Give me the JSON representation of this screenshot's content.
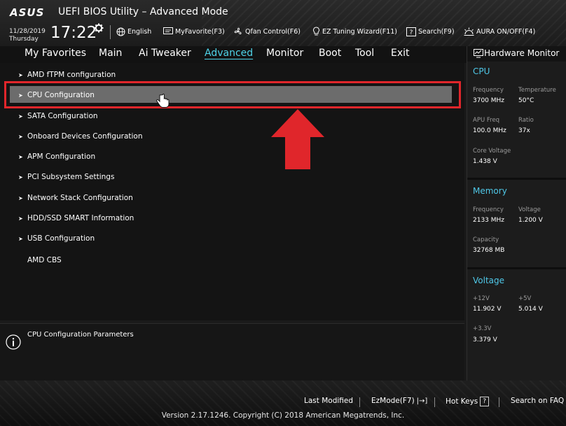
{
  "header": {
    "brand": "ASUS",
    "title": "UEFI BIOS Utility – Advanced Mode",
    "date": "11/28/2019",
    "weekday": "Thursday",
    "time": "17:22",
    "tools": [
      {
        "label": "English",
        "icon": "globe-icon"
      },
      {
        "label": "MyFavorite(F3)",
        "icon": "favorite-screen-icon"
      },
      {
        "label": "Qfan Control(F6)",
        "icon": "fan-icon"
      },
      {
        "label": "EZ Tuning Wizard(F11)",
        "icon": "bulb-icon"
      },
      {
        "label": "Search(F9)",
        "icon": "search-help-icon"
      },
      {
        "label": "AURA ON/OFF(F4)",
        "icon": "aura-icon"
      }
    ]
  },
  "tabs": [
    {
      "label": "My Favorites",
      "active": false
    },
    {
      "label": "Main",
      "active": false
    },
    {
      "label": "Ai Tweaker",
      "active": false
    },
    {
      "label": "Advanced",
      "active": true
    },
    {
      "label": "Monitor",
      "active": false
    },
    {
      "label": "Boot",
      "active": false
    },
    {
      "label": "Tool",
      "active": false
    },
    {
      "label": "Exit",
      "active": false
    }
  ],
  "menu": [
    {
      "label": "AMD fTPM configuration",
      "arrow": true
    },
    {
      "label": "CPU Configuration",
      "arrow": true,
      "selected": true
    },
    {
      "label": "SATA Configuration",
      "arrow": true
    },
    {
      "label": "Onboard Devices Configuration",
      "arrow": true
    },
    {
      "label": "APM Configuration",
      "arrow": true
    },
    {
      "label": "PCI Subsystem Settings",
      "arrow": true
    },
    {
      "label": "Network Stack Configuration",
      "arrow": true
    },
    {
      "label": "HDD/SSD SMART Information",
      "arrow": true
    },
    {
      "label": "USB Configuration",
      "arrow": true
    },
    {
      "label": "AMD CBS",
      "arrow": false
    }
  ],
  "info": {
    "text": "CPU Configuration Parameters"
  },
  "hwmon": {
    "title": "Hardware Monitor",
    "cpu": {
      "heading": "CPU",
      "frequency_label": "Frequency",
      "frequency": "3700 MHz",
      "temperature_label": "Temperature",
      "temperature": "50°C",
      "apu_label": "APU Freq",
      "apu": "100.0 MHz",
      "ratio_label": "Ratio",
      "ratio": "37x",
      "core_voltage_label": "Core Voltage",
      "core_voltage": "1.438 V"
    },
    "memory": {
      "heading": "Memory",
      "frequency_label": "Frequency",
      "frequency": "2133 MHz",
      "voltage_label": "Voltage",
      "voltage": "1.200 V",
      "capacity_label": "Capacity",
      "capacity": "32768 MB"
    },
    "voltage": {
      "heading": "Voltage",
      "v12_label": "+12V",
      "v12": "11.902 V",
      "v5_label": "+5V",
      "v5": "5.014 V",
      "v33_label": "+3.3V",
      "v33": "3.379 V"
    }
  },
  "footer": {
    "last_modified": "Last Modified",
    "ezmode": "EzMode(F7)",
    "hot_keys": "Hot Keys",
    "hot_keys_key": "?",
    "search_faq": "Search on FAQ",
    "copyright": "Version 2.17.1246. Copyright (C) 2018 American Megatrends, Inc."
  },
  "colors": {
    "accent": "#4fd3e8",
    "highlight_red": "#e0262b",
    "selected_row": "#6c6c6c"
  }
}
